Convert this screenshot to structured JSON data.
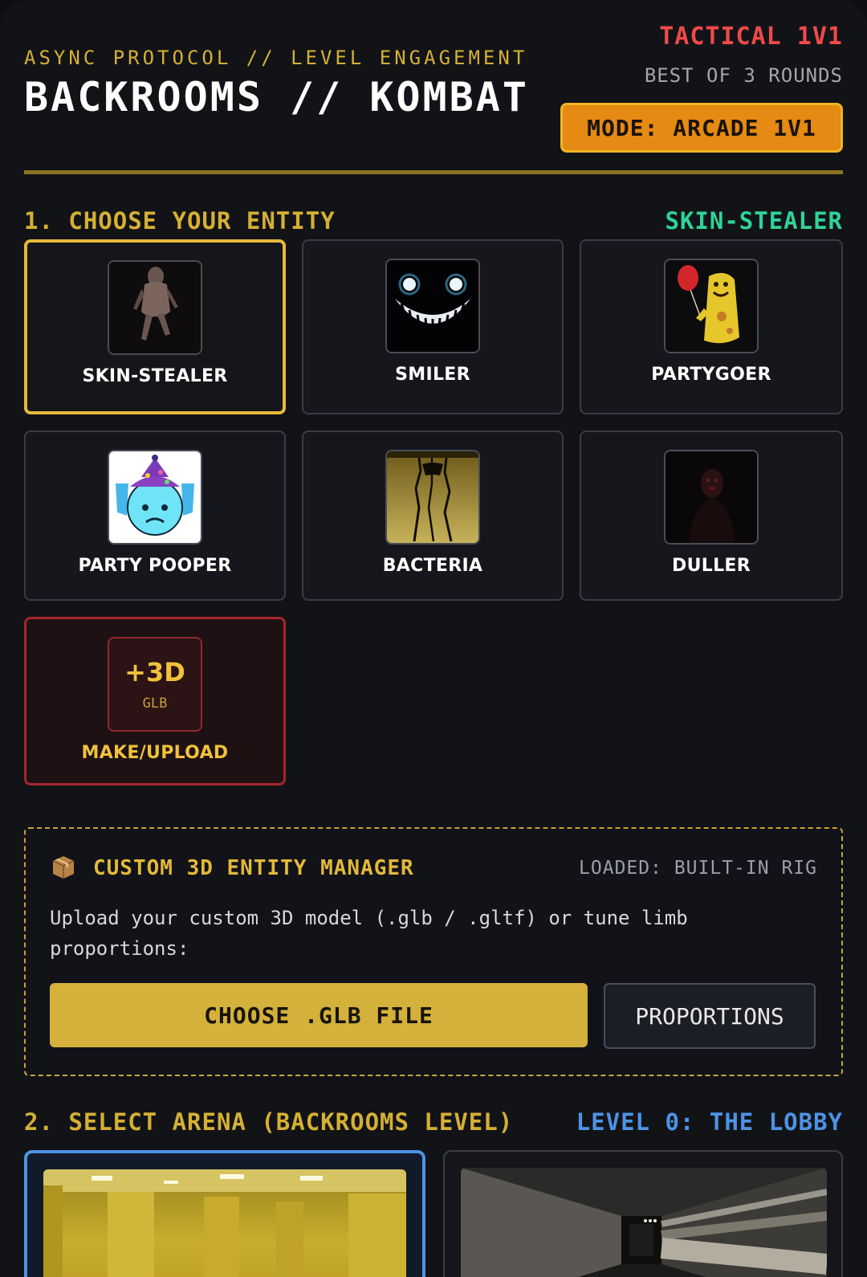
{
  "header": {
    "eyebrow": "ASYNC PROTOCOL // LEVEL ENGAGEMENT",
    "title": "BACKROOMS // KOMBAT",
    "mode_tag": "TACTICAL 1V1",
    "rounds": "BEST OF 3 ROUNDS",
    "mode_button": "MODE: ARCADE 1V1"
  },
  "entities": {
    "heading": "1. CHOOSE YOUR ENTITY",
    "selected": "SKIN-STEALER",
    "selected_color": "#2fd39a",
    "items": [
      {
        "label": "SKIN-STEALER",
        "icon": "skin-stealer-portrait"
      },
      {
        "label": "SMILER",
        "icon": "smiler-portrait"
      },
      {
        "label": "PARTYGOER",
        "icon": "partygoer-portrait"
      },
      {
        "label": "PARTY POOPER",
        "icon": "party-pooper-portrait"
      },
      {
        "label": "BACTERIA",
        "icon": "bacteria-portrait"
      },
      {
        "label": "DULLER",
        "icon": "duller-portrait"
      }
    ],
    "upload": {
      "badge": "+3D",
      "sub": "GLB",
      "label": "MAKE/UPLOAD"
    }
  },
  "manager": {
    "icon": "package-icon",
    "title": "CUSTOM 3D ENTITY MANAGER",
    "loaded": "LOADED: BUILT-IN RIG",
    "description": "Upload your custom 3D model (.glb / .gltf) or tune limb proportions:",
    "choose_button": "CHOOSE .GLB FILE",
    "proportions_button": "PROPORTIONS"
  },
  "arena": {
    "heading": "2. SELECT ARENA (BACKROOMS LEVEL)",
    "selected": "LEVEL 0: THE LOBBY",
    "selected_color": "#4d93e6"
  }
}
